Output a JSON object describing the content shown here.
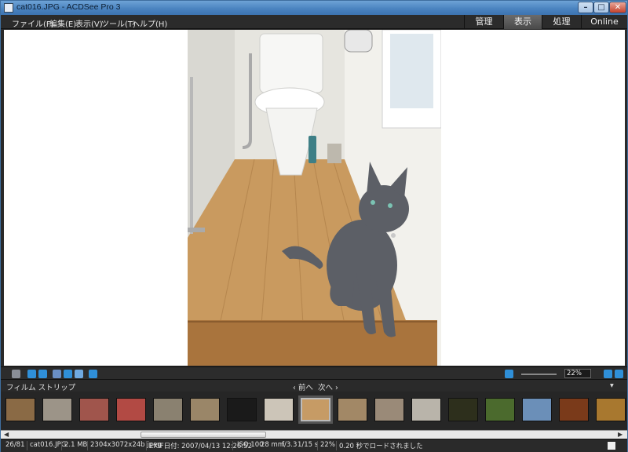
{
  "window": {
    "title": "cat016.JPG - ACDSee Pro 3",
    "controls": {
      "minimize": "–",
      "maximize": "□",
      "close": "✕"
    }
  },
  "menu": {
    "items": [
      "ファイル(F)",
      "編集(E)",
      "表示(V)",
      "ツール(T)",
      "ヘルプ(H)"
    ],
    "modes": [
      "管理",
      "表示",
      "処理",
      "Online"
    ],
    "active_mode": "表示"
  },
  "toolbar": {
    "icons": [
      "print-icon",
      "save-icon",
      "copy-icon",
      "hand-tool-icon",
      "select-tool-icon",
      "zoom-tool-icon",
      "fullscreen-icon"
    ],
    "zoom": "22%"
  },
  "filmstrip": {
    "label": "フィルム ストリップ",
    "prev": "‹ 前へ",
    "next": "次へ ›",
    "thumbnail_count": 17,
    "selected_index": 8
  },
  "status": {
    "position": "26/81",
    "filename": "cat016.JPG",
    "filesize": "2.1 MB",
    "dimensions": "2304x3072x24b jpeg",
    "exif": "EXIF日付: 2007/04/13 12:26:52",
    "iso": "ISO 100",
    "focal": "28 mm",
    "aperture": "f/3.3",
    "shutter": "1/15 s",
    "zoom": "22%",
    "load_time": "0.20 秒でロードされました"
  },
  "colors": {
    "titlebar": "#4b84c0",
    "chrome": "#2a2a2a",
    "active_mode": "#5a5a5a",
    "accent_blue": "#2f8fd8"
  }
}
